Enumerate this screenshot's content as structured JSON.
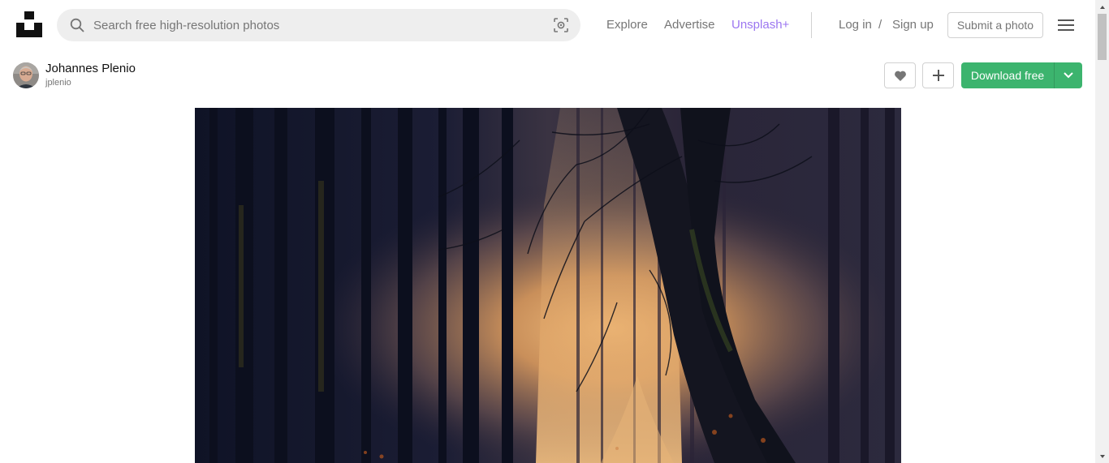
{
  "header": {
    "logo_icon": "unsplash-logo-icon",
    "search": {
      "placeholder": "Search free high-resolution photos",
      "value": "",
      "icon": "search-icon",
      "visual_search_icon": "visual-search-icon"
    },
    "nav": {
      "explore": "Explore",
      "advertise": "Advertise",
      "unsplash_plus": "Unsplash+",
      "login": "Log in",
      "separator": "/",
      "signup": "Sign up"
    },
    "submit_label": "Submit a photo",
    "menu_icon": "hamburger-menu-icon",
    "colors": {
      "unsplash_plus": "#9b76f0",
      "muted_text": "#767676"
    }
  },
  "photographer": {
    "name": "Johannes Plenio",
    "handle": "jplenio",
    "avatar_icon": "avatar"
  },
  "actions": {
    "like_icon": "heart-icon",
    "collect_icon": "plus-icon",
    "download_label": "Download free",
    "download_dropdown_icon": "chevron-down-icon",
    "colors": {
      "download": "#3cb46e"
    }
  },
  "photo": {
    "subject": "misty forest path",
    "colors": {
      "glow": "#e8a860",
      "dark": "#15162a"
    }
  }
}
